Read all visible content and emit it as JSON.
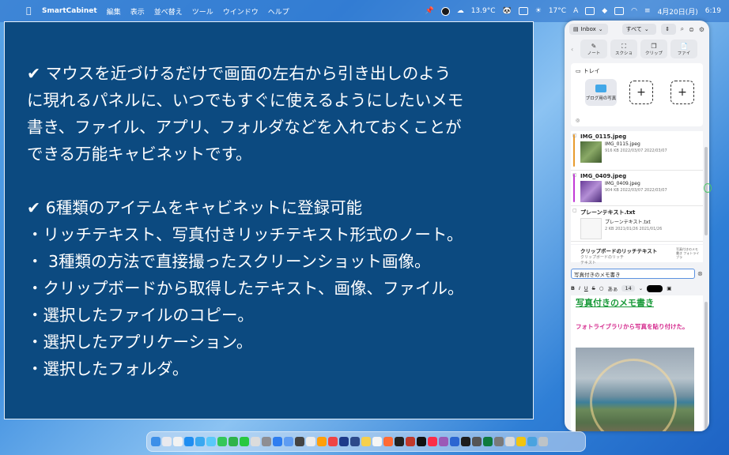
{
  "menubar": {
    "app_name": "SmartCabinet",
    "menus": [
      "編集",
      "表示",
      "並べ替え",
      "ツール",
      "ウインドウ",
      "ヘルプ"
    ],
    "weather": "13.9°C",
    "temp": "17°C",
    "input_indicator": "A",
    "date": "4月20日(月)",
    "time": "6:19"
  },
  "info": {
    "line1": "✔ マウスを近づけるだけで画面の左右から引き出しのよう",
    "line2": "に現れるパネルに、いつでもすぐに使えるようにしたいメモ",
    "line3": "書き、ファイル、アプリ、フォルダなどを入れておくことが",
    "line4": "できる万能キャビネットです。",
    "line5": "✔ 6種類のアイテムをキャビネットに登録可能",
    "line6": "・リッチテキスト、写真付きリッチテキスト形式のノート。",
    "line7": "・ 3種類の方法で直接撮ったスクリーンショット画像。",
    "line8": "・クリップボードから取得したテキスト、画像、ファイル。",
    "line9": "・選択したファイルのコピー。",
    "line10": "・選択したアプリケーション。",
    "line11": "・選択したフォルダ。"
  },
  "panel": {
    "inbox": "Inbox",
    "filter_all": "すべて",
    "tools": [
      {
        "label": "ノート",
        "icon": "note-icon"
      },
      {
        "label": "スクショ",
        "icon": "screenshot-icon"
      },
      {
        "label": "クリップ",
        "icon": "clipboard-icon"
      },
      {
        "label": "ファイ",
        "icon": "file-icon"
      }
    ],
    "tray_label": "トレイ",
    "tray_folder": "ブログ用の写真",
    "items": [
      {
        "name": "IMG_0115.jpeg",
        "file": "IMG_0115.jpeg",
        "meta": "916 KB  2022/03/07  2022/03/07",
        "color": "#e89b2e"
      },
      {
        "name": "IMG_0409.jpeg",
        "file": "IMG_0409.jpeg",
        "meta": "904 KB  2022/03/07  2022/03/07",
        "color": "#c23ad6"
      },
      {
        "name": "プレーンテキスト.txt",
        "file": "プレーンテキスト.txt",
        "meta": "2 KB  2021/01/26  2021/01/26",
        "color": "#bbbbbb"
      }
    ],
    "clip_name": "クリップボードのリッチテキスト",
    "clip_sub": "クリップボードのリッチ",
    "clip_sub2": "テキスト",
    "clip_side": "写真付きのメモ書き フォトライブラ",
    "note_title": "写真付きのメモ書き",
    "format": {
      "bold": "B",
      "italic": "I",
      "underline": "U",
      "strike": "S",
      "font": "あぁ",
      "size": "14"
    },
    "editor_heading": "写真付きのメモ書き",
    "editor_text": "フォトライブラリから写真を貼り付けた。"
  }
}
